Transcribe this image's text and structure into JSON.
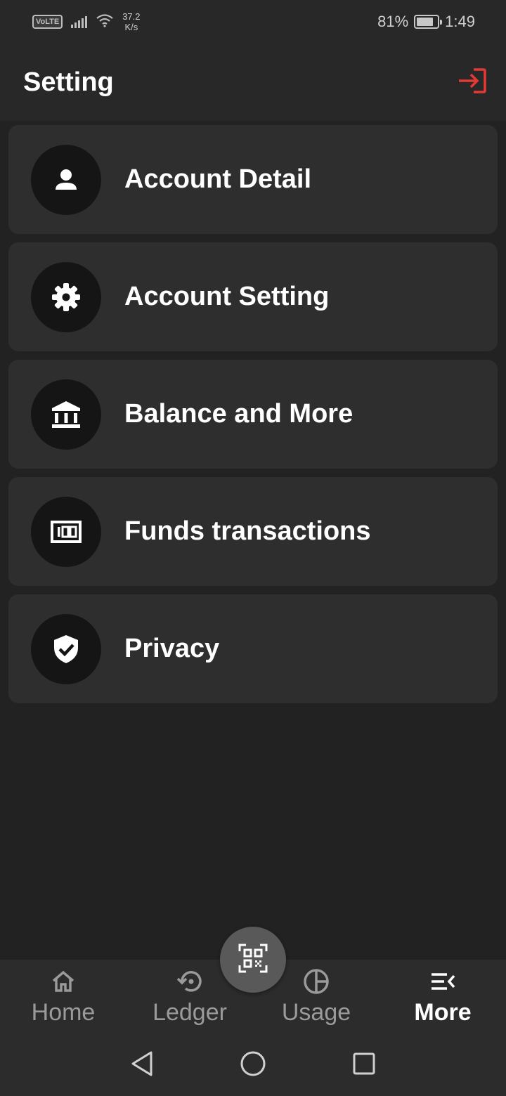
{
  "status_bar": {
    "volte": "VoLTE",
    "speed_value": "37.2",
    "speed_unit": "K/s",
    "battery": "81%",
    "time": "1:49",
    "battery_level": 0.81
  },
  "header": {
    "title": "Setting",
    "logout_icon": "logout-arrow-icon",
    "logout_color": "#e53935"
  },
  "menu": {
    "items": [
      {
        "label": "Account Detail",
        "icon": "person-icon"
      },
      {
        "label": "Account Setting",
        "icon": "gear-icon"
      },
      {
        "label": "Balance and More",
        "icon": "bank-icon"
      },
      {
        "label": "Funds transactions",
        "icon": "money-icon"
      },
      {
        "label": "Privacy",
        "icon": "shield-check-icon"
      }
    ]
  },
  "bottom_nav": {
    "items": [
      {
        "label": "Home",
        "icon": "home-icon"
      },
      {
        "label": "Ledger",
        "icon": "history-icon"
      },
      {
        "label": "Usage",
        "icon": "pie-chart-icon"
      },
      {
        "label": "More",
        "icon": "menu-open-icon"
      }
    ],
    "active": "More",
    "fab_icon": "qr-scan-icon"
  },
  "system_nav": {
    "back": "back-icon",
    "home": "home-circle-icon",
    "recents": "recents-square-icon"
  }
}
